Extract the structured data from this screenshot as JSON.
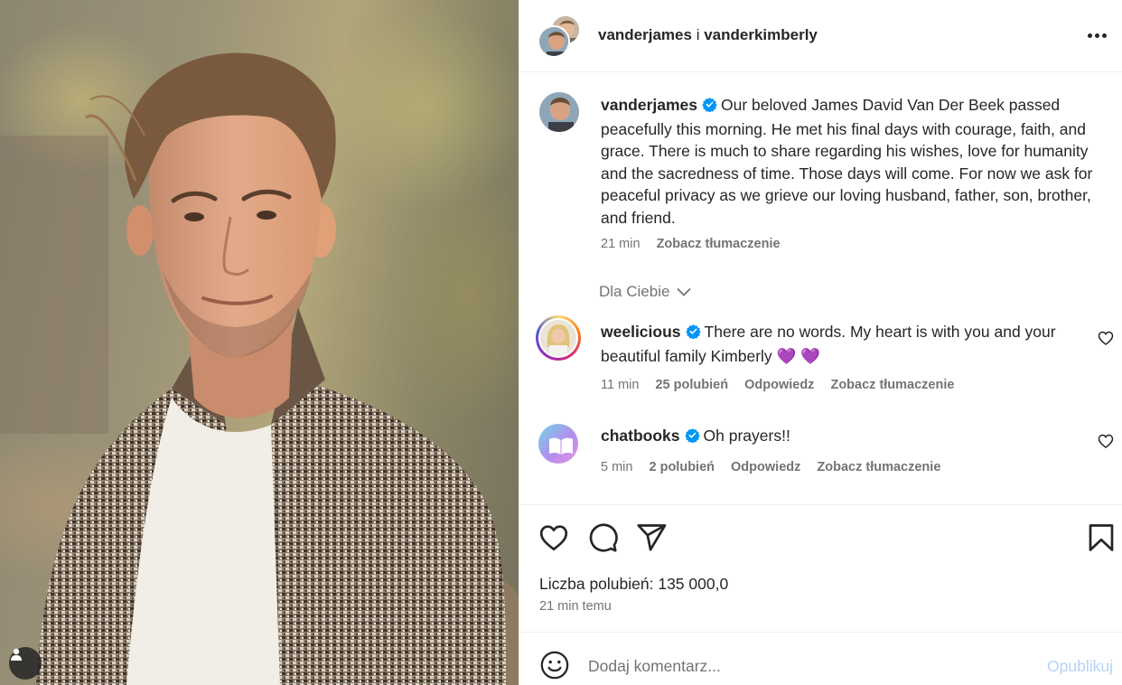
{
  "photo": {
    "alt_subject": "portrait-photo",
    "user_tag_icon": "person-icon"
  },
  "header": {
    "username_primary": "vanderjames",
    "conjunction": "i",
    "username_secondary": "vanderkimberly",
    "more_icon": "more-horizontal-icon"
  },
  "caption": {
    "username": "vanderjames",
    "text": "Our beloved James David Van Der Beek passed peacefully this morning. He met his final days with courage, faith, and grace. There is much to share regarding his wishes, love for humanity and the sacredness of time. Those days will come. For now we ask for peaceful privacy as we grieve our loving husband, father, son, brother, and friend.",
    "time": "21 min",
    "translate_label": "Zobacz tłumaczenie"
  },
  "for_you_label": "Dla Ciebie",
  "comments": [
    {
      "username": "weelicious",
      "text": "There are no words. My heart is with you and your beautiful family Kimberly 💜 💜",
      "time": "11 min",
      "likes": "25 polubień",
      "reply_label": "Odpowiedz",
      "translate_label": "Zobacz tłumaczenie"
    },
    {
      "username": "chatbooks",
      "text": "Oh prayers!!",
      "time": "5 min",
      "likes": "2 polubień",
      "reply_label": "Odpowiedz",
      "translate_label": "Zobacz tłumaczenie"
    }
  ],
  "actions": {
    "icons": [
      "heart-icon",
      "comment-icon",
      "share-icon",
      "bookmark-icon"
    ],
    "likes_text": "Liczba polubień: 135 000,0",
    "time_ago": "21 min temu"
  },
  "add_comment": {
    "placeholder": "Dodaj komentarz...",
    "publish_label": "Opublikuj"
  },
  "colors": {
    "verified": "#0095f6",
    "muted": "#737373",
    "publish_disabled": "#b5d3f7",
    "text": "#262626"
  }
}
